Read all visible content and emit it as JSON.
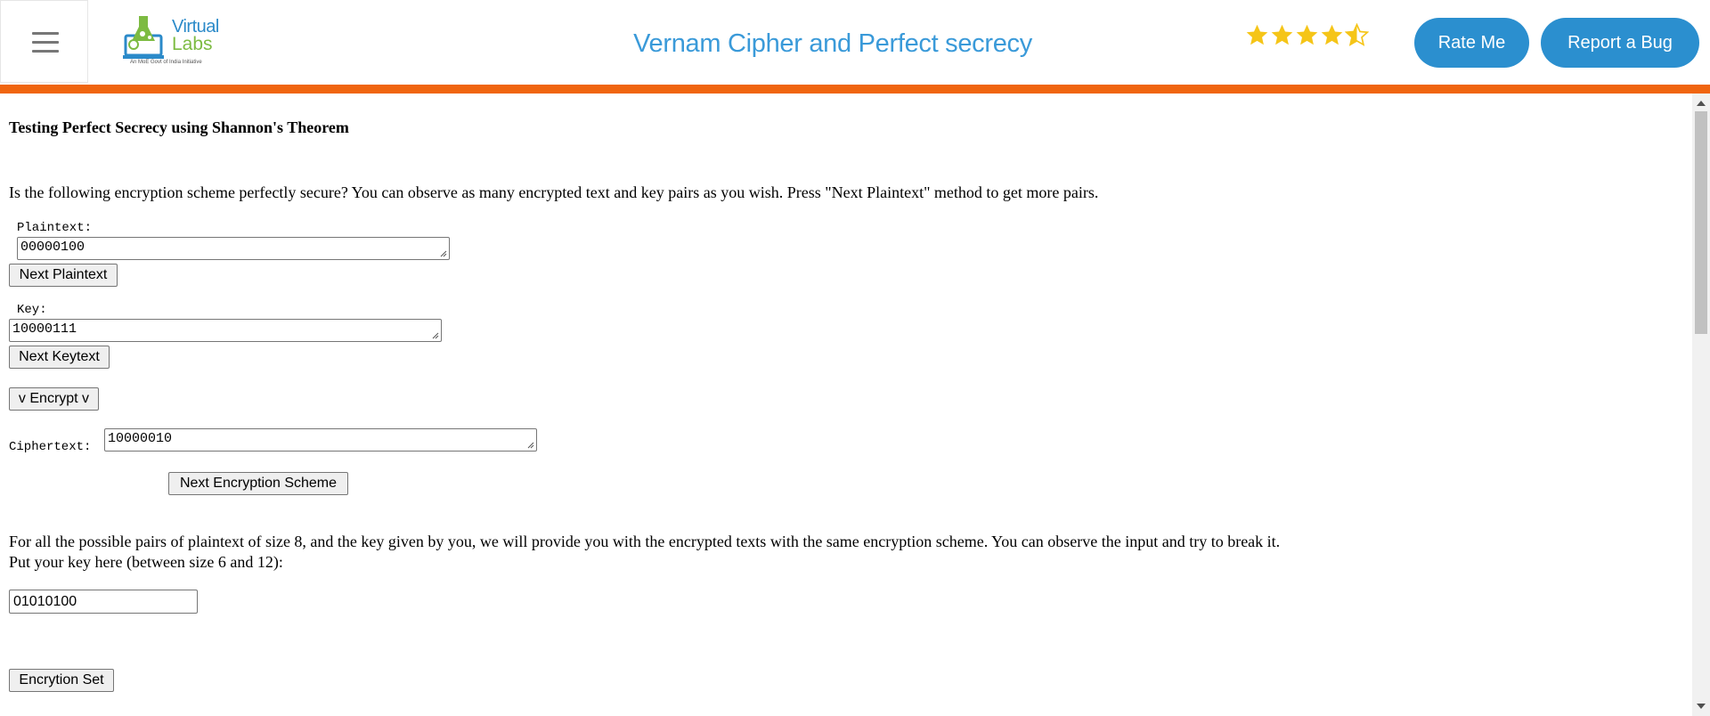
{
  "header": {
    "logo": {
      "line1": "Virtual",
      "line2": "Labs",
      "tagline": "An MoE Govt of India Initiative"
    },
    "title": "Vernam Cipher and Perfect secrecy",
    "rating": {
      "value": 4.5,
      "max": 5
    },
    "rate_button": "Rate Me",
    "bug_button": "Report a Bug",
    "colors": {
      "accent": "#2b8fcf",
      "bar": "#f0650f",
      "title": "#3a9ad9",
      "star": "#f5c518"
    }
  },
  "content": {
    "heading": "Testing Perfect Secrecy using Shannon's Theorem",
    "intro": "Is the following encryption scheme perfectly secure? You can observe as many encrypted text and key pairs as you wish. Press \"Next Plaintext\" method to get more pairs.",
    "plaintext_label": "Plaintext:",
    "plaintext_value": "00000100",
    "next_plaintext_button": "Next Plaintext",
    "key_label": "Key:",
    "key_value": "10000111",
    "next_keytext_button": "Next Keytext",
    "encrypt_button": "v Encrypt v",
    "ciphertext_label": "Ciphertext:",
    "ciphertext_value": "10000010",
    "next_scheme_button": "Next Encryption Scheme",
    "pairs_text": "For all the possible pairs of plaintext of size 8, and the key given by you, we will provide you with the encrypted texts with the same encryption scheme. You can observe the input and try to break it.",
    "key_prompt": "Put your key here (between size 6 and 12):",
    "user_key_value": "01010100",
    "encryption_set_button": "Encrytion Set"
  }
}
